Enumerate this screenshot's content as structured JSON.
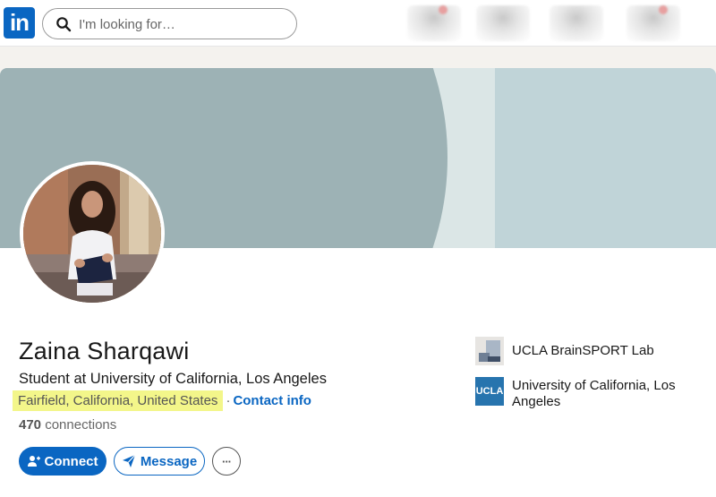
{
  "nav": {
    "logo_text": "in",
    "search_placeholder": "I'm looking for…"
  },
  "profile": {
    "name": "Zaina Sharqawi",
    "headline": "Student at University of California, Los Angeles",
    "location": "Fairfield, California, United States",
    "separator": "·",
    "contact_info": "Contact info",
    "connections_count": "470",
    "connections_label": "connections"
  },
  "actions": {
    "connect_label": "Connect",
    "message_label": "Message",
    "more_label": "···"
  },
  "sidebar": {
    "items": [
      {
        "label": "UCLA BrainSPORT Lab",
        "icon": "lab-logo"
      },
      {
        "label": "University of California, Los Angeles",
        "icon": "ucla-logo",
        "logo_text": "UCLA"
      }
    ]
  },
  "colors": {
    "brand": "#0a66c2",
    "highlight": "#f3f68a",
    "banner": "#9db2b5"
  }
}
